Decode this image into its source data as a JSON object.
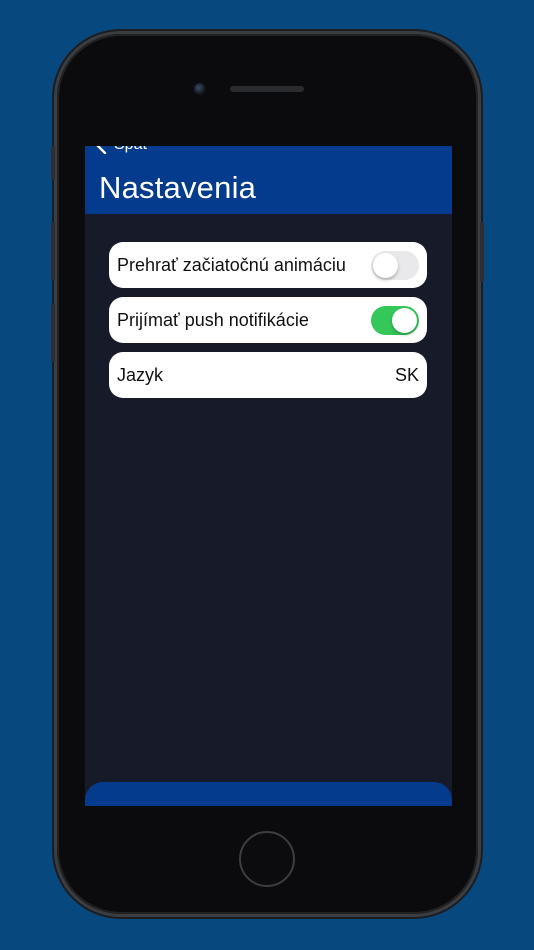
{
  "app": {
    "back_label": "Späť",
    "title": "Nastavenia"
  },
  "colors": {
    "background": "#07487f",
    "nav_bar": "#053b8c",
    "screen_background": "#171b29",
    "toggle_on": "#34c759",
    "toggle_off": "#e9e9eb"
  },
  "settings": [
    {
      "label": "Prehrať začiatočnú animáciu",
      "toggle": false
    },
    {
      "label": "Prijímať push notifikácie",
      "toggle": true
    },
    {
      "label": "Jazyk",
      "value": "SK"
    }
  ],
  "icons": {
    "back": "chevron-left-icon"
  }
}
